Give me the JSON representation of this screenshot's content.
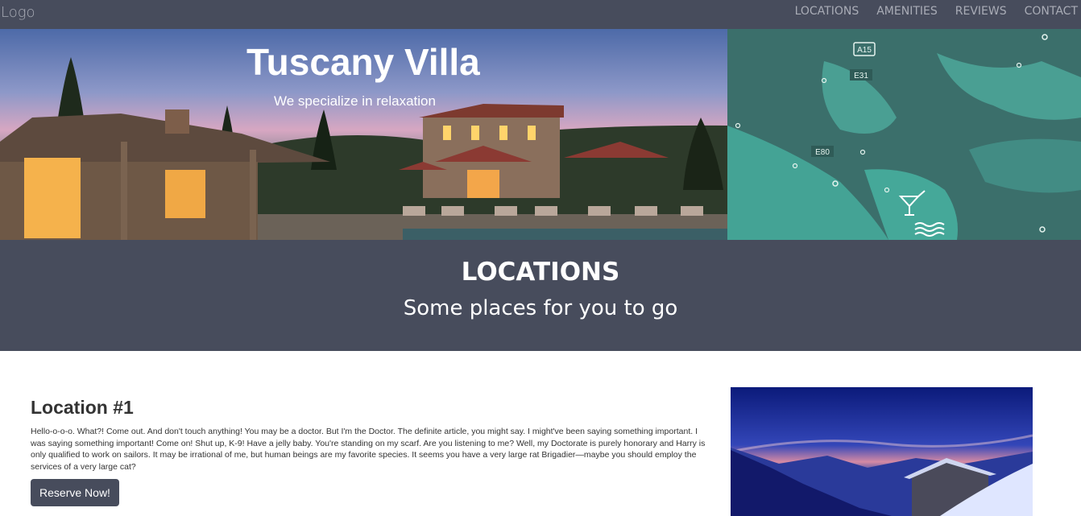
{
  "navbar": {
    "logo": "Logo",
    "links": [
      "LOCATIONS",
      "AMENITIES",
      "REVIEWS",
      "CONTACT"
    ]
  },
  "hero": {
    "title": "Tuscany Villa",
    "subtitle": "We specialize in relaxation",
    "image_icon": "villa-photo"
  },
  "map": {
    "icon": "map-image",
    "road_labels": [
      "A15",
      "E31",
      "E80"
    ]
  },
  "locations": {
    "title": "LOCATIONS",
    "subtitle": "Some places for you to go"
  },
  "location1": {
    "title": "Location #1",
    "text": "Hello-o-o-o. What?! Come out. And don't touch anything! You may be a doctor. But I'm the Doctor. The definite article, you might say. I might've been saying something important. I was saying something important! Come on! Shut up, K-9! Have a jelly baby. You're standing on my scarf. Are you listening to me? Well, my Doctorate is purely honorary and Harry is only qualified to work on sailors. It may be irrational of me, but human beings are my favorite species. It seems you have a very large rat Brigadier—maybe you should employ the services of a very large cat?",
    "button": "Reserve Now!",
    "image_icon": "mountain-photo"
  },
  "colors": {
    "nav_bg": "#474c5c",
    "nav_text": "#a9acb6",
    "map_bg": "#3d8b82"
  }
}
